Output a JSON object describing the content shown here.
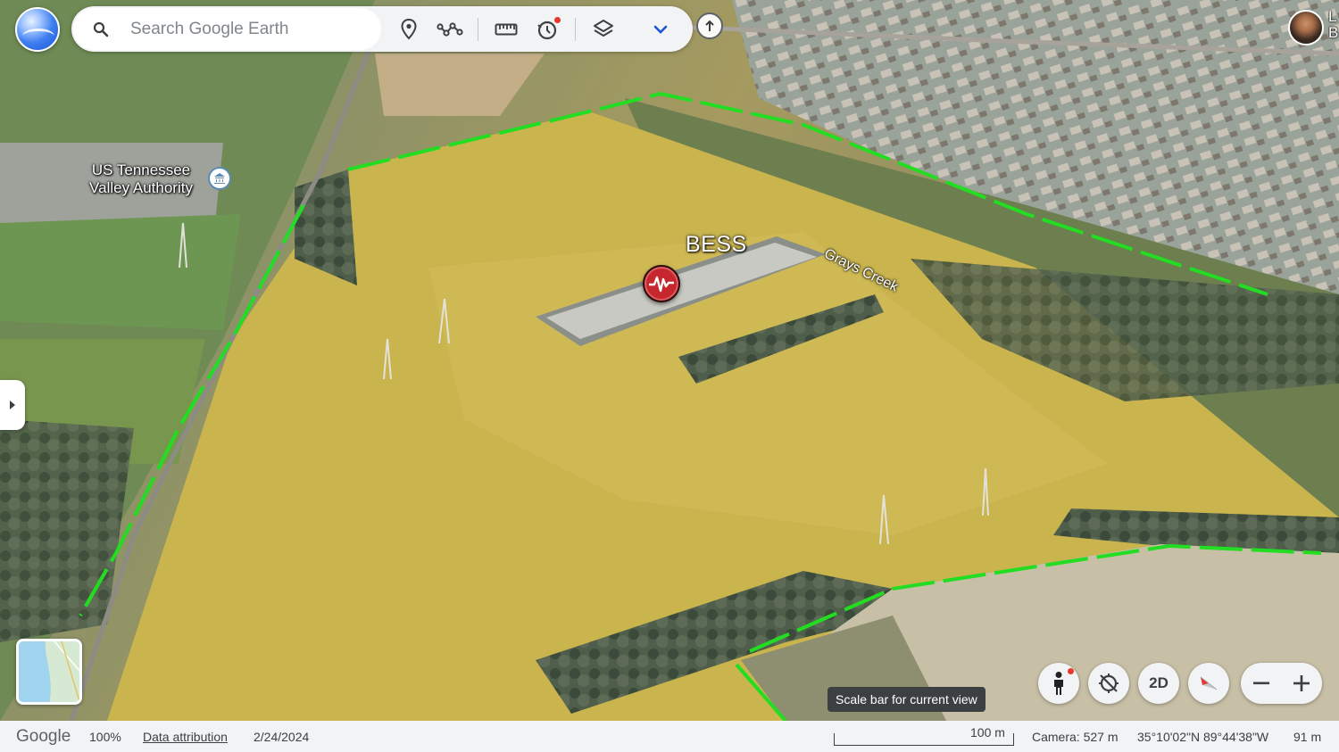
{
  "search": {
    "placeholder": "Search Google Earth"
  },
  "toolbar": {
    "icons": [
      "search-icon",
      "location-pin-icon",
      "path-icon",
      "ruler-icon",
      "timelapse-icon",
      "layers-icon",
      "chevron-down-icon",
      "new-project-icon"
    ]
  },
  "account": {
    "name": "L\nB"
  },
  "map_labels": {
    "tva": "US Tennessee\nValley Authority",
    "bess": "BESS",
    "creek": "Grays Creek"
  },
  "controls": {
    "mode_2d": "2D"
  },
  "tooltip": "Scale bar for current view",
  "status": {
    "google": "Google",
    "zoom": "100%",
    "data_attribution": "Data attribution",
    "date": "2/24/2024",
    "scale": "100 m",
    "camera": "Camera: 527 m",
    "coords": "35°10'02\"N 89°44'38\"W",
    "elevation": "91 m"
  },
  "colors": {
    "boundary": "#22dd22",
    "field": "#c9b44e",
    "pin_red": "#c6262e"
  }
}
